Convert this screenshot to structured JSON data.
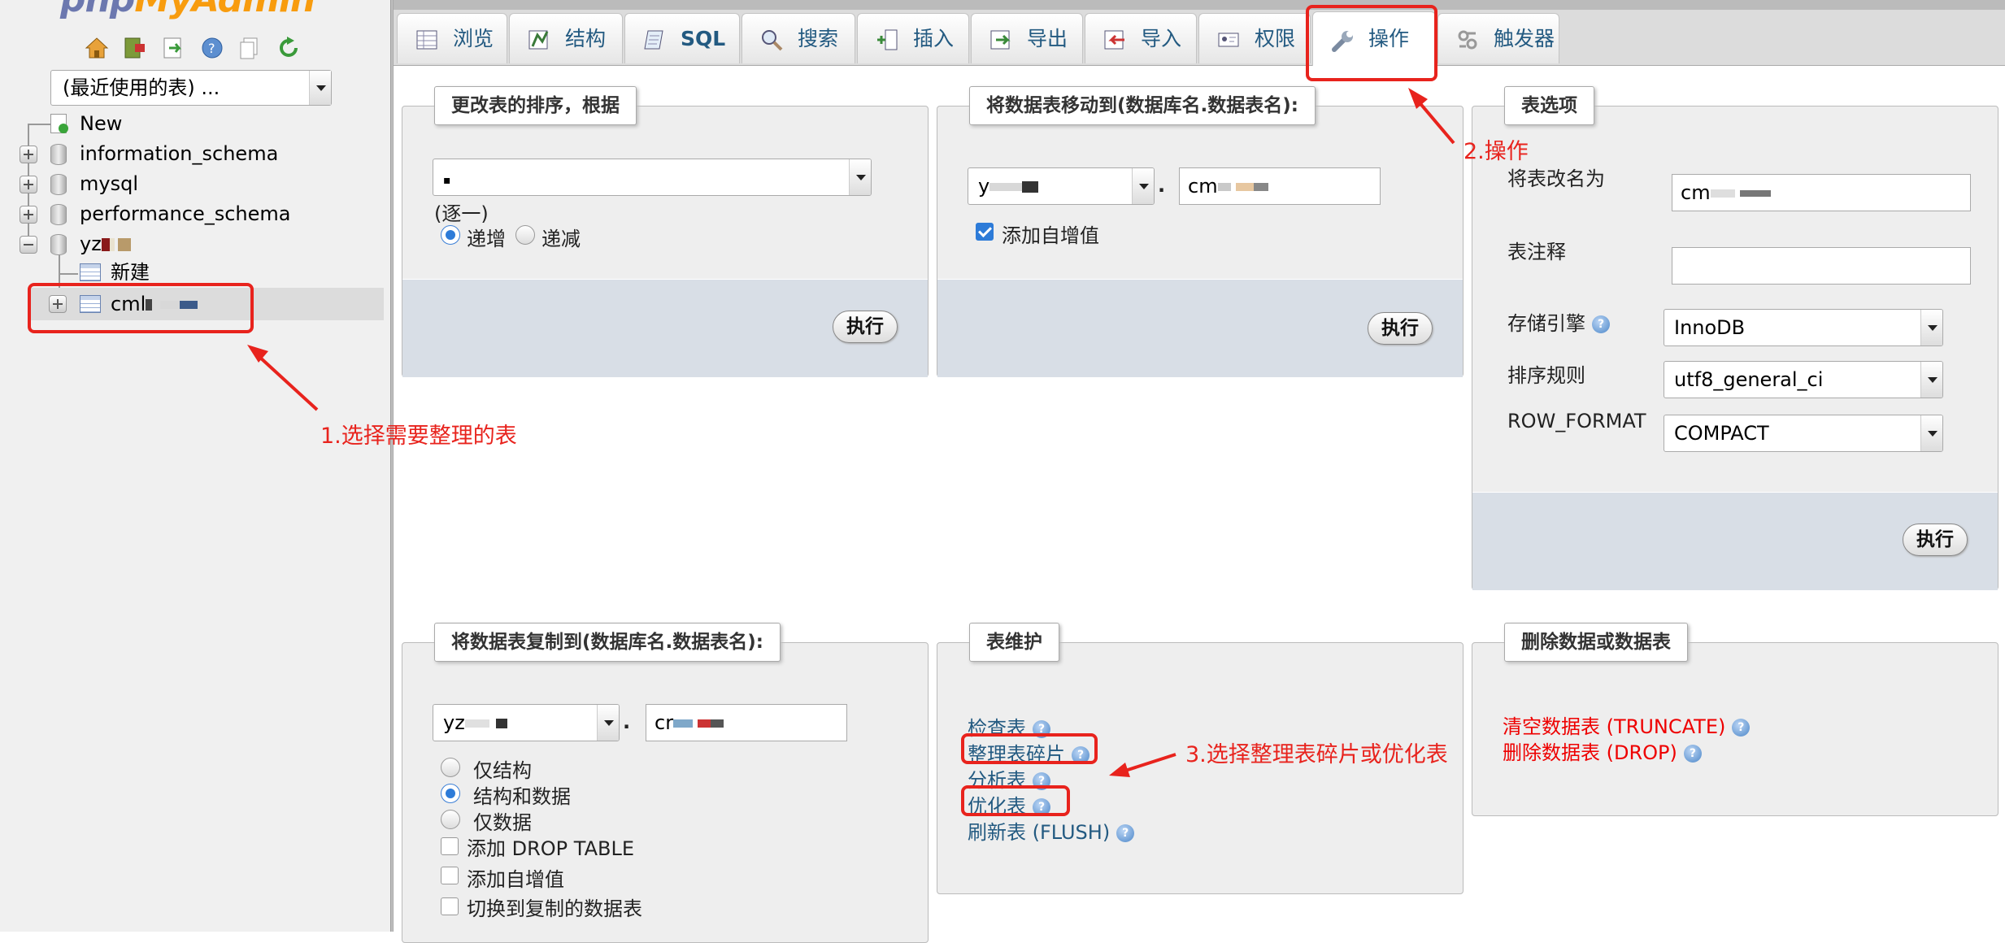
{
  "app": {
    "logo_left": "php",
    "logo_right": "MyAdmin"
  },
  "sidebar": {
    "recent_select": "(最近使用的表) ...",
    "tree": [
      {
        "label": "New",
        "type": "new"
      },
      {
        "label": "information_schema",
        "type": "db"
      },
      {
        "label": "mysql",
        "type": "db"
      },
      {
        "label": "performance_schema",
        "type": "db"
      },
      {
        "label": "yz",
        "type": "db-open"
      },
      {
        "label": "新建",
        "type": "new-table"
      },
      {
        "label": "cml",
        "type": "table-selected"
      }
    ]
  },
  "tabs": [
    {
      "label": "浏览",
      "icon": "browse-icon"
    },
    {
      "label": "结构",
      "icon": "structure-icon"
    },
    {
      "label": "SQL",
      "icon": "sql-icon"
    },
    {
      "label": "搜索",
      "icon": "search-icon"
    },
    {
      "label": "插入",
      "icon": "insert-icon"
    },
    {
      "label": "导出",
      "icon": "export-icon"
    },
    {
      "label": "导入",
      "icon": "import-icon"
    },
    {
      "label": "权限",
      "icon": "privileges-icon"
    },
    {
      "label": "操作",
      "icon": "wrench-icon"
    },
    {
      "label": "触发器",
      "icon": "triggers-icon"
    }
  ],
  "panels": {
    "sort": {
      "legend": "更改表的排序，根据",
      "select_value": "▪",
      "each": "(逐一)",
      "asc": "递增",
      "desc": "递减",
      "exec": "执行"
    },
    "move": {
      "legend": "将数据表移动到(数据库名.数据表名):",
      "db_value": "y",
      "dot": ".",
      "table_value": "cm",
      "auto_inc": "添加自增值",
      "exec": "执行"
    },
    "options": {
      "legend": "表选项",
      "rename_label": "将表改名为",
      "rename_value": "cm",
      "comment_label": "表注释",
      "comment_value": "",
      "engine_label": "存储引擎",
      "engine_value": "InnoDB",
      "collation_label": "排序规则",
      "collation_value": "utf8_general_ci",
      "rowformat_label": "ROW_FORMAT",
      "rowformat_value": "COMPACT",
      "exec": "执行"
    },
    "copy": {
      "legend": "将数据表复制到(数据库名.数据表名):",
      "db_value": "yz",
      "dot": ".",
      "table_value": "cr",
      "opt_structure": "仅结构",
      "opt_both": "结构和数据",
      "opt_data": "仅数据",
      "drop_table": "添加 DROP TABLE",
      "auto_inc": "添加自增值",
      "switch": "切换到复制的数据表"
    },
    "maintenance": {
      "legend": "表维护",
      "check": "检查表",
      "defrag": "整理表碎片",
      "analyze": "分析表",
      "optimize": "优化表",
      "flush": "刷新表 (FLUSH)"
    },
    "delete": {
      "legend": "删除数据或数据表",
      "truncate": "清空数据表 (TRUNCATE)",
      "drop": "删除数据表 (DROP)"
    }
  },
  "annotations": {
    "step1": "1.选择需要整理的表",
    "step2": "2.操作",
    "step3": "3.选择整理表碎片或优化表"
  },
  "colors": {
    "link": "#235a81",
    "annotation": "#e8231d",
    "danger": "#e00000"
  }
}
